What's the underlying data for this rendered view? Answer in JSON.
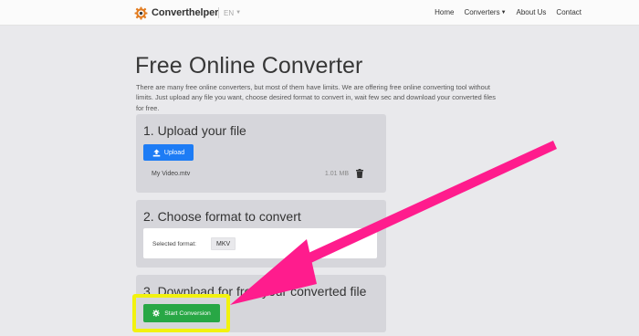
{
  "navbar": {
    "brand": "Converthelper",
    "language": "EN",
    "links": [
      "Home",
      "Converters",
      "About Us",
      "Contact"
    ]
  },
  "page": {
    "title": "Free Online Converter",
    "intro": "There are many free online converters, but most of them have limits. We are offering free online converting tool without limits. Just upload any file you want, choose desired format to convert in, wait few sec and download your converted files for free."
  },
  "step1": {
    "title": "1. Upload your file",
    "upload_label": "Upload",
    "file": {
      "name": "My Video.mtv",
      "size": "1.01 MB"
    }
  },
  "step2": {
    "title": "2. Choose format to convert",
    "format_label": "Selected format:",
    "format_value": "MKV"
  },
  "step3": {
    "title": "3. Download for free your converted file",
    "start_label": "Start Conversion"
  },
  "colors": {
    "upload_button": "#1d7cf5",
    "start_button": "#28a745",
    "annotation_arrow": "#ff1c8d",
    "highlight_box": "#f2f20e"
  },
  "icons": [
    "converthelper-logo-icon",
    "chevron-down-icon",
    "upload-icon",
    "trash-icon",
    "gear-icon",
    "annotation-arrow"
  ]
}
